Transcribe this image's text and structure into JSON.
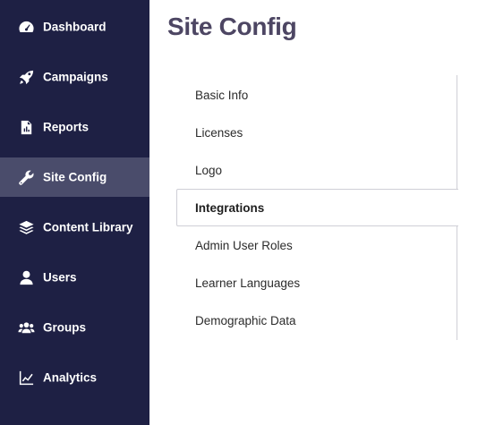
{
  "sidebar": {
    "items": [
      {
        "label": "Dashboard",
        "icon": "dashboard-gauge-icon"
      },
      {
        "label": "Campaigns",
        "icon": "rocket-icon"
      },
      {
        "label": "Reports",
        "icon": "report-document-icon"
      },
      {
        "label": "Site Config",
        "icon": "wrench-icon",
        "active": true
      },
      {
        "label": "Content Library",
        "icon": "layers-icon"
      },
      {
        "label": "Users",
        "icon": "user-icon"
      },
      {
        "label": "Groups",
        "icon": "users-group-icon"
      },
      {
        "label": "Analytics",
        "icon": "line-chart-icon"
      }
    ]
  },
  "main": {
    "title": "Site Config",
    "tabs": [
      {
        "label": "Basic Info"
      },
      {
        "label": "Licenses"
      },
      {
        "label": "Logo"
      },
      {
        "label": "Integrations",
        "active": true
      },
      {
        "label": "Admin User Roles"
      },
      {
        "label": "Learner Languages"
      },
      {
        "label": "Demographic Data"
      }
    ]
  },
  "colors": {
    "sidebar_bg": "#1e2044",
    "sidebar_active_bg": "#4a4c6b",
    "title_color": "#4d4663",
    "border": "#cfcfd6"
  }
}
